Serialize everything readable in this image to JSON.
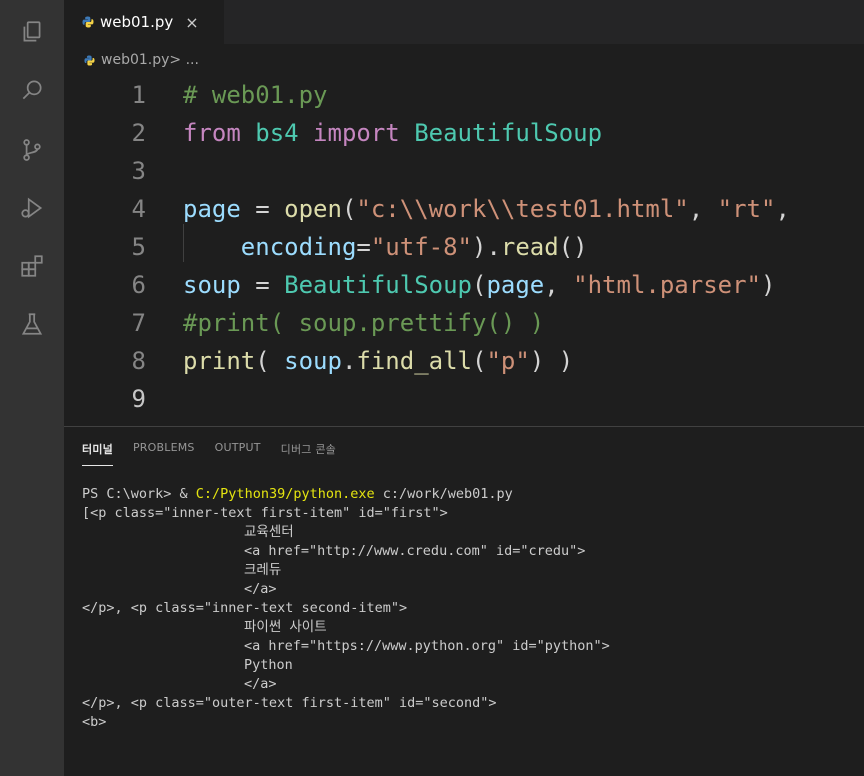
{
  "tab": {
    "filename": "web01.py",
    "close": "×"
  },
  "breadcrumb": {
    "file": "web01.py",
    "rest": " > ..."
  },
  "editor": {
    "lines": [
      {
        "num": "1",
        "tokens": [
          {
            "t": "# web01.py",
            "c": "tok-comment"
          }
        ]
      },
      {
        "num": "2",
        "tokens": [
          {
            "t": "from",
            "c": "tok-kw"
          },
          {
            "t": " bs4 ",
            "c": "tok-cls"
          },
          {
            "t": "import",
            "c": "tok-kw"
          },
          {
            "t": " BeautifulSoup",
            "c": "tok-cls"
          }
        ]
      },
      {
        "num": "3",
        "tokens": []
      },
      {
        "num": "4",
        "tokens": [
          {
            "t": "page",
            "c": "tok-var"
          },
          {
            "t": " = ",
            "c": "tok-op"
          },
          {
            "t": "open",
            "c": "tok-fn"
          },
          {
            "t": "(",
            "c": "tok-op"
          },
          {
            "t": "\"c:\\\\work\\\\test01.html\"",
            "c": "tok-str"
          },
          {
            "t": ", ",
            "c": "tok-op"
          },
          {
            "t": "\"rt\"",
            "c": "tok-str"
          },
          {
            "t": ",",
            "c": "tok-op"
          }
        ]
      },
      {
        "num": "5",
        "tokens": [
          {
            "t": "    encoding",
            "c": "tok-var"
          },
          {
            "t": "=",
            "c": "tok-op"
          },
          {
            "t": "\"utf-8\"",
            "c": "tok-str"
          },
          {
            "t": ").",
            "c": "tok-op"
          },
          {
            "t": "read",
            "c": "tok-fn"
          },
          {
            "t": "()",
            "c": "tok-op"
          }
        ]
      },
      {
        "num": "6",
        "tokens": [
          {
            "t": "soup",
            "c": "tok-var"
          },
          {
            "t": " = ",
            "c": "tok-op"
          },
          {
            "t": "BeautifulSoup",
            "c": "tok-cls"
          },
          {
            "t": "(",
            "c": "tok-op"
          },
          {
            "t": "page",
            "c": "tok-var"
          },
          {
            "t": ", ",
            "c": "tok-op"
          },
          {
            "t": "\"html.parser\"",
            "c": "tok-str"
          },
          {
            "t": ")",
            "c": "tok-op"
          }
        ]
      },
      {
        "num": "7",
        "tokens": [
          {
            "t": "#print( soup.prettify() )",
            "c": "tok-comment"
          }
        ]
      },
      {
        "num": "8",
        "tokens": [
          {
            "t": "print",
            "c": "tok-fn"
          },
          {
            "t": "( ",
            "c": "tok-op"
          },
          {
            "t": "soup",
            "c": "tok-var"
          },
          {
            "t": ".",
            "c": "tok-op"
          },
          {
            "t": "find_all",
            "c": "tok-fn"
          },
          {
            "t": "(",
            "c": "tok-op"
          },
          {
            "t": "\"p\"",
            "c": "tok-str"
          },
          {
            "t": ") )",
            "c": "tok-op"
          }
        ]
      },
      {
        "num": "9",
        "tokens": []
      }
    ]
  },
  "panel": {
    "tabs": [
      "터미널",
      "PROBLEMS",
      "OUTPUT",
      "디버그 콘솔"
    ],
    "active_tab": 0
  },
  "terminal": {
    "prompt_prefix": "PS C:\\work> & ",
    "prompt_exe": "C:/Python39/python.exe",
    "prompt_args": " c:/work/web01.py",
    "lines": [
      {
        "text": "[<p class=\"inner-text first-item\" id=\"first\">",
        "indent": false
      },
      {
        "text": "교육센터",
        "indent": true
      },
      {
        "text": "<a href=\"http://www.credu.com\" id=\"credu\">",
        "indent": true
      },
      {
        "text": "크레듀",
        "indent": true
      },
      {
        "text": "</a>",
        "indent": true
      },
      {
        "text": "</p>, <p class=\"inner-text second-item\">",
        "indent": false
      },
      {
        "text": "파이썬 사이트",
        "indent": true
      },
      {
        "text": "<a href=\"https://www.python.org\" id=\"python\">",
        "indent": true
      },
      {
        "text": "Python",
        "indent": true
      },
      {
        "text": "</a>",
        "indent": true
      },
      {
        "text": "</p>, <p class=\"outer-text first-item\" id=\"second\">",
        "indent": false
      },
      {
        "text": "<b>",
        "indent": false
      }
    ]
  },
  "colors": {
    "background": "#1e1e1e",
    "activity_bar": "#333333",
    "keyword": "#c586c0",
    "string": "#ce9178",
    "class": "#4ec9b0",
    "function": "#dcdcaa",
    "variable": "#9cdcfe",
    "comment": "#6a9955",
    "terminal_path": "#e5e510"
  },
  "activity_icons": [
    "explorer-icon",
    "search-icon",
    "source-control-icon",
    "run-debug-icon",
    "extensions-icon",
    "testing-icon"
  ]
}
